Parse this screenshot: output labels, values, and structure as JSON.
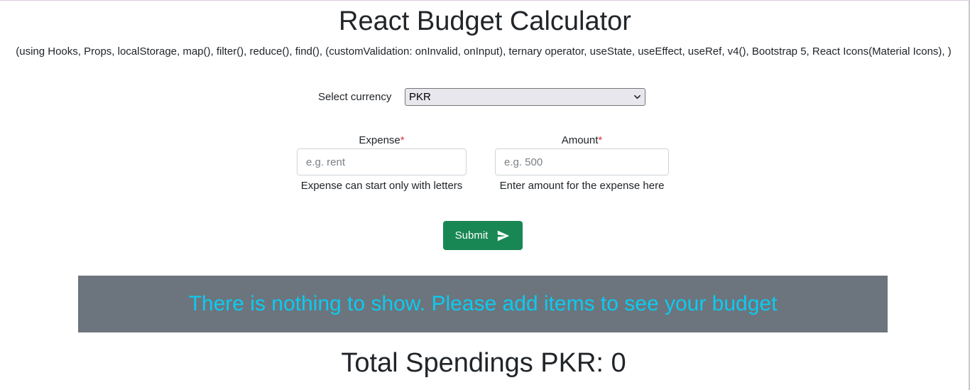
{
  "header": {
    "title": "React Budget Calculator",
    "subtitle": "(using Hooks, Props, localStorage, map(), filter(), reduce(), find(), (customValidation: onInvalid, onInput), ternary operator, useState, useEffect, useRef, v4(), Bootstrap 5, React Icons(Material Icons), )"
  },
  "currency": {
    "label": "Select currency",
    "selected": "PKR",
    "icon": "chevron-down-icon"
  },
  "form": {
    "expense": {
      "label": "Expense",
      "required_mark": "*",
      "placeholder": "e.g. rent",
      "value": "",
      "help": "Expense can start only with letters"
    },
    "amount": {
      "label": "Amount",
      "required_mark": "*",
      "placeholder": "e.g. 500",
      "value": "",
      "help": "Enter amount for the expense here"
    },
    "submit": {
      "label": "Submit",
      "icon": "send-icon"
    }
  },
  "list": {
    "empty_message": "There is nothing to show. Please add items to see your budget"
  },
  "total": {
    "label": "Total Spendings PKR: 0"
  },
  "colors": {
    "submit_bg": "#198754",
    "banner_bg": "#6c757d",
    "banner_text": "#0dcaf0",
    "required": "#dc3545"
  }
}
